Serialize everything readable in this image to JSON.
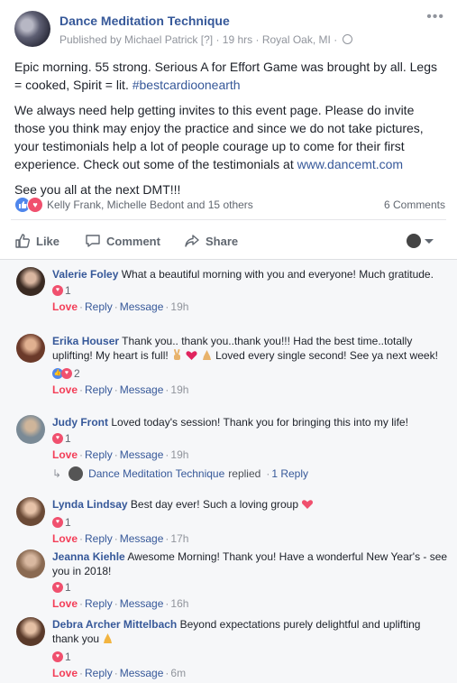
{
  "post": {
    "page_name": "Dance Meditation Technique",
    "published_by": "Published by Michael Patrick",
    "question_mark": "[?]",
    "time": "19 hrs",
    "location": "Royal Oak, MI",
    "paragraphs": {
      "p1_text": "Epic morning. 55 strong. Serious A for Effort Game was brought by all. Legs = cooked, Spirit = lit. ",
      "p1_hashtag": "#bestcardioonearth",
      "p2_text": "We always need help getting invites to this event page. Please do invite those you think may enjoy the practice and since we do not take pictures, your testimonials help a lot of people courage up to come for their first experience. Check out some of the testimonials at ",
      "p2_link": "www.dancemt.com",
      "p3_text": "See you all at the next DMT!!!"
    },
    "reactions_names": "Kelly Frank, Michelle Bedont and 15 others",
    "comments_count": "6 Comments"
  },
  "actions": {
    "like": "Like",
    "comment": "Comment",
    "share": "Share"
  },
  "comment_ui": {
    "love": "Love",
    "reply": "Reply",
    "message": "Message"
  },
  "comments": [
    {
      "author": "Valerie Foley",
      "text": "What a beautiful morning with you and everyone! Much gratitude.",
      "react_count": "1",
      "time": "19h"
    },
    {
      "author": "Erika Houser",
      "text_a": "Thank you.. thank you..thank you!!! Had the best time..totally uplifting! My heart is full! ",
      "text_b": " Loved every single second! See ya next week!",
      "react_count": "2",
      "time": "19h"
    },
    {
      "author": "Judy Front",
      "text": "Loved today's session! Thank you for bringing this into my life!",
      "react_count": "1",
      "time": "19h"
    },
    {
      "author": "Lynda Lindsay",
      "text": "Best day ever! Such a loving group ",
      "react_count": "1",
      "time": "17h"
    },
    {
      "author": "Jeanna Kiehle",
      "text": "Awesome Morning! Thank you! Have a wonderful New Year's - see you in 2018!",
      "react_count": "1",
      "time": "16h"
    },
    {
      "author": "Debra Archer Mittelbach",
      "text": "Beyond expectations purely delightful and uplifting thank you ",
      "react_count": "1",
      "time": "6m"
    }
  ],
  "reply_summary": {
    "page_name": "Dance Meditation Technique",
    "replied": "replied",
    "count": "1 Reply"
  },
  "colors": {
    "link_blue": "#365899",
    "love_red": "#f33e58",
    "like_blue": "#4f86ec",
    "meta_gray": "#90949c"
  }
}
